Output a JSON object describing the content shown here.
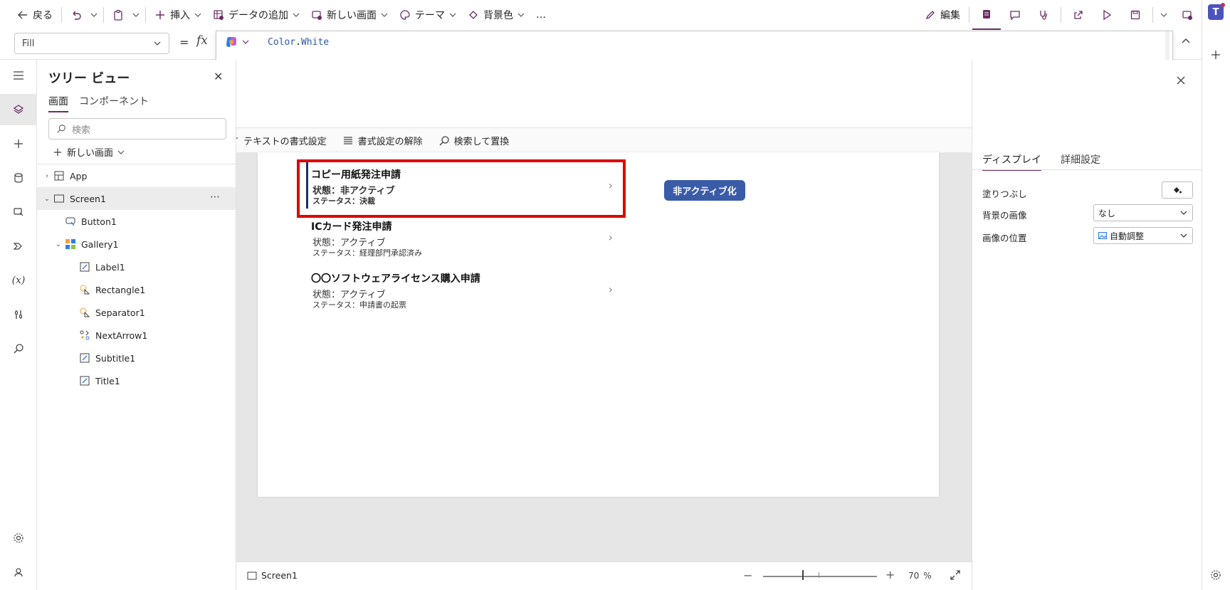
{
  "toolbar": {
    "back_label": "戻る",
    "insert_label": "挿入",
    "add_data_label": "データの追加",
    "new_screen_label": "新しい画面",
    "theme_label": "テーマ",
    "background_label": "背景色",
    "more_label": "…",
    "edit_label": "編集"
  },
  "formula": {
    "property": "Fill",
    "fx": "fx",
    "equals": "=",
    "expression_object": "Color",
    "expression_dot": ".",
    "expression_member": "White",
    "tools": {
      "format_text": "テキストの書式設定",
      "remove_format": "書式設定の解除",
      "find_replace": "検索して置換"
    }
  },
  "tree": {
    "title": "ツリー ビュー",
    "tabs": [
      "画面",
      "コンポーネント"
    ],
    "search_placeholder": "検索",
    "new_screen": "新しい画面",
    "nodes": [
      {
        "label": "App"
      },
      {
        "label": "Screen1",
        "more": "⋯"
      },
      {
        "label": "Button1"
      },
      {
        "label": "Gallery1"
      },
      {
        "label": "Label1"
      },
      {
        "label": "Rectangle1"
      },
      {
        "label": "Separator1"
      },
      {
        "label": "NextArrow1"
      },
      {
        "label": "Subtitle1"
      },
      {
        "label": "Title1"
      }
    ]
  },
  "gallery": {
    "items": [
      {
        "title": "コピー用紙発注申請",
        "subtitle": "状態：非アクティブ",
        "status": "ステータス：決裁"
      },
      {
        "title": "ICカード発注申請",
        "subtitle": "状態：アクティブ",
        "status": "ステータス：経理部門承認済み"
      },
      {
        "title": "〇〇ソフトウェアライセンス購入申請",
        "subtitle": "状態：アクティブ",
        "status": "ステータス：申請書の起票"
      }
    ],
    "button_label": "非アクティブ化"
  },
  "statusbar": {
    "screen_name": "Screen1",
    "zoom_value": "70",
    "zoom_unit": "%",
    "minus": "−",
    "plus": "+"
  },
  "properties": {
    "tabs": [
      "ディスプレイ",
      "詳細設定"
    ],
    "fill_label": "塗りつぶし",
    "bg_image_label": "背景の画像",
    "bg_image_value": "なし",
    "image_position_label": "画像の位置",
    "image_position_value": "自動調整"
  },
  "colors": {
    "accent": "#6b2c63",
    "selection": "#e00000",
    "button_bg": "#3a5ba8",
    "formula_text": "#2b5aa8"
  }
}
